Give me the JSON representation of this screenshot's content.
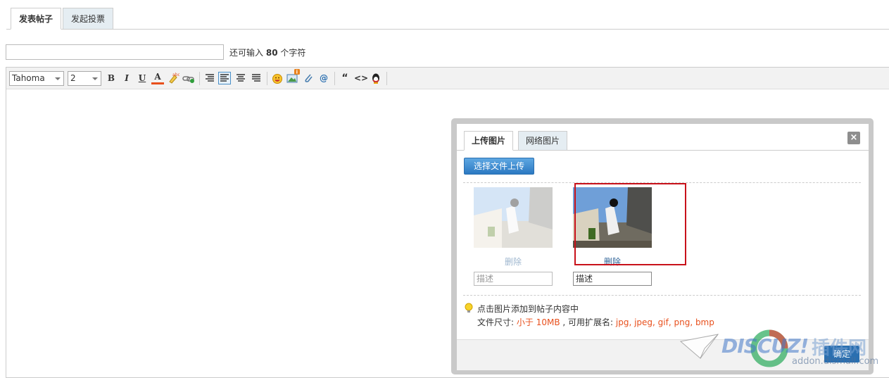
{
  "tabs": {
    "post": "发表帖子",
    "poll": "发起投票"
  },
  "subject": {
    "counter_prefix": "还可输入",
    "counter_value": "80",
    "counter_suffix": "个字符"
  },
  "toolbar": {
    "font_name": "Tahoma",
    "font_size": "2",
    "bold": "B",
    "italic": "I",
    "underline": "U",
    "color": "A",
    "mention": "@",
    "quote": "“",
    "code": "<>"
  },
  "dialog": {
    "tab_upload": "上传图片",
    "tab_network": "网络图片",
    "close": "×",
    "upload_button": "选择文件上传",
    "images": [
      {
        "delete_label": "删除",
        "description_placeholder": "描述"
      },
      {
        "delete_label": "删除",
        "description_placeholder": "描述"
      }
    ],
    "tip": "点击图片添加到帖子内容中",
    "size_prefix": "文件尺寸:",
    "size_value": "小于 10MB",
    "ext_prefix": ", 可用扩展名:",
    "ext_value": "jpg, jpeg, gif, png, bmp",
    "ok_button": "确定"
  },
  "watermark": {
    "brand": "DISCUZ!",
    "cn": "插件网",
    "url": "addon.dismall.com"
  },
  "colors": {
    "accent": "#2a6fb0",
    "highlight": "#c8111a",
    "notice": "#e8501d"
  }
}
